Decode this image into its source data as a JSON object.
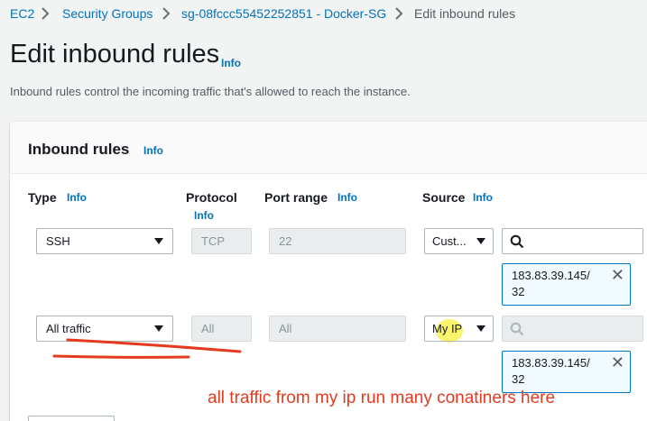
{
  "breadcrumb": {
    "items": [
      "EC2",
      "Security Groups",
      "sg-08fccc55452252851 - Docker-SG",
      "Edit inbound rules"
    ]
  },
  "page": {
    "title": "Edit inbound rules",
    "info": "Info",
    "description": "Inbound rules control the incoming traffic that's allowed to reach the instance."
  },
  "panel": {
    "title": "Inbound rules",
    "info": "Info"
  },
  "columns": {
    "type": "Type",
    "protocol": "Protocol",
    "port_range": "Port range",
    "source": "Source",
    "info": "Info"
  },
  "rules": [
    {
      "type": "SSH",
      "protocol": "TCP",
      "port_range": "22",
      "source": "Cust...",
      "search_placeholder": "",
      "token_line1": "183.83.39.145/",
      "token_line2": "32"
    },
    {
      "type": "All traffic",
      "protocol": "All",
      "port_range": "All",
      "source": "My IP",
      "search_placeholder": "",
      "token_line1": "183.83.39.145/",
      "token_line2": "32"
    }
  ],
  "annotation": "all traffic from my ip run many conatiners here",
  "colors": {
    "link": "#0073bb",
    "annotation": "#e43a20",
    "background": "#f2f3f3"
  },
  "icons": [
    "chevron-right-icon",
    "caret-down-icon",
    "search-icon",
    "close-icon"
  ]
}
